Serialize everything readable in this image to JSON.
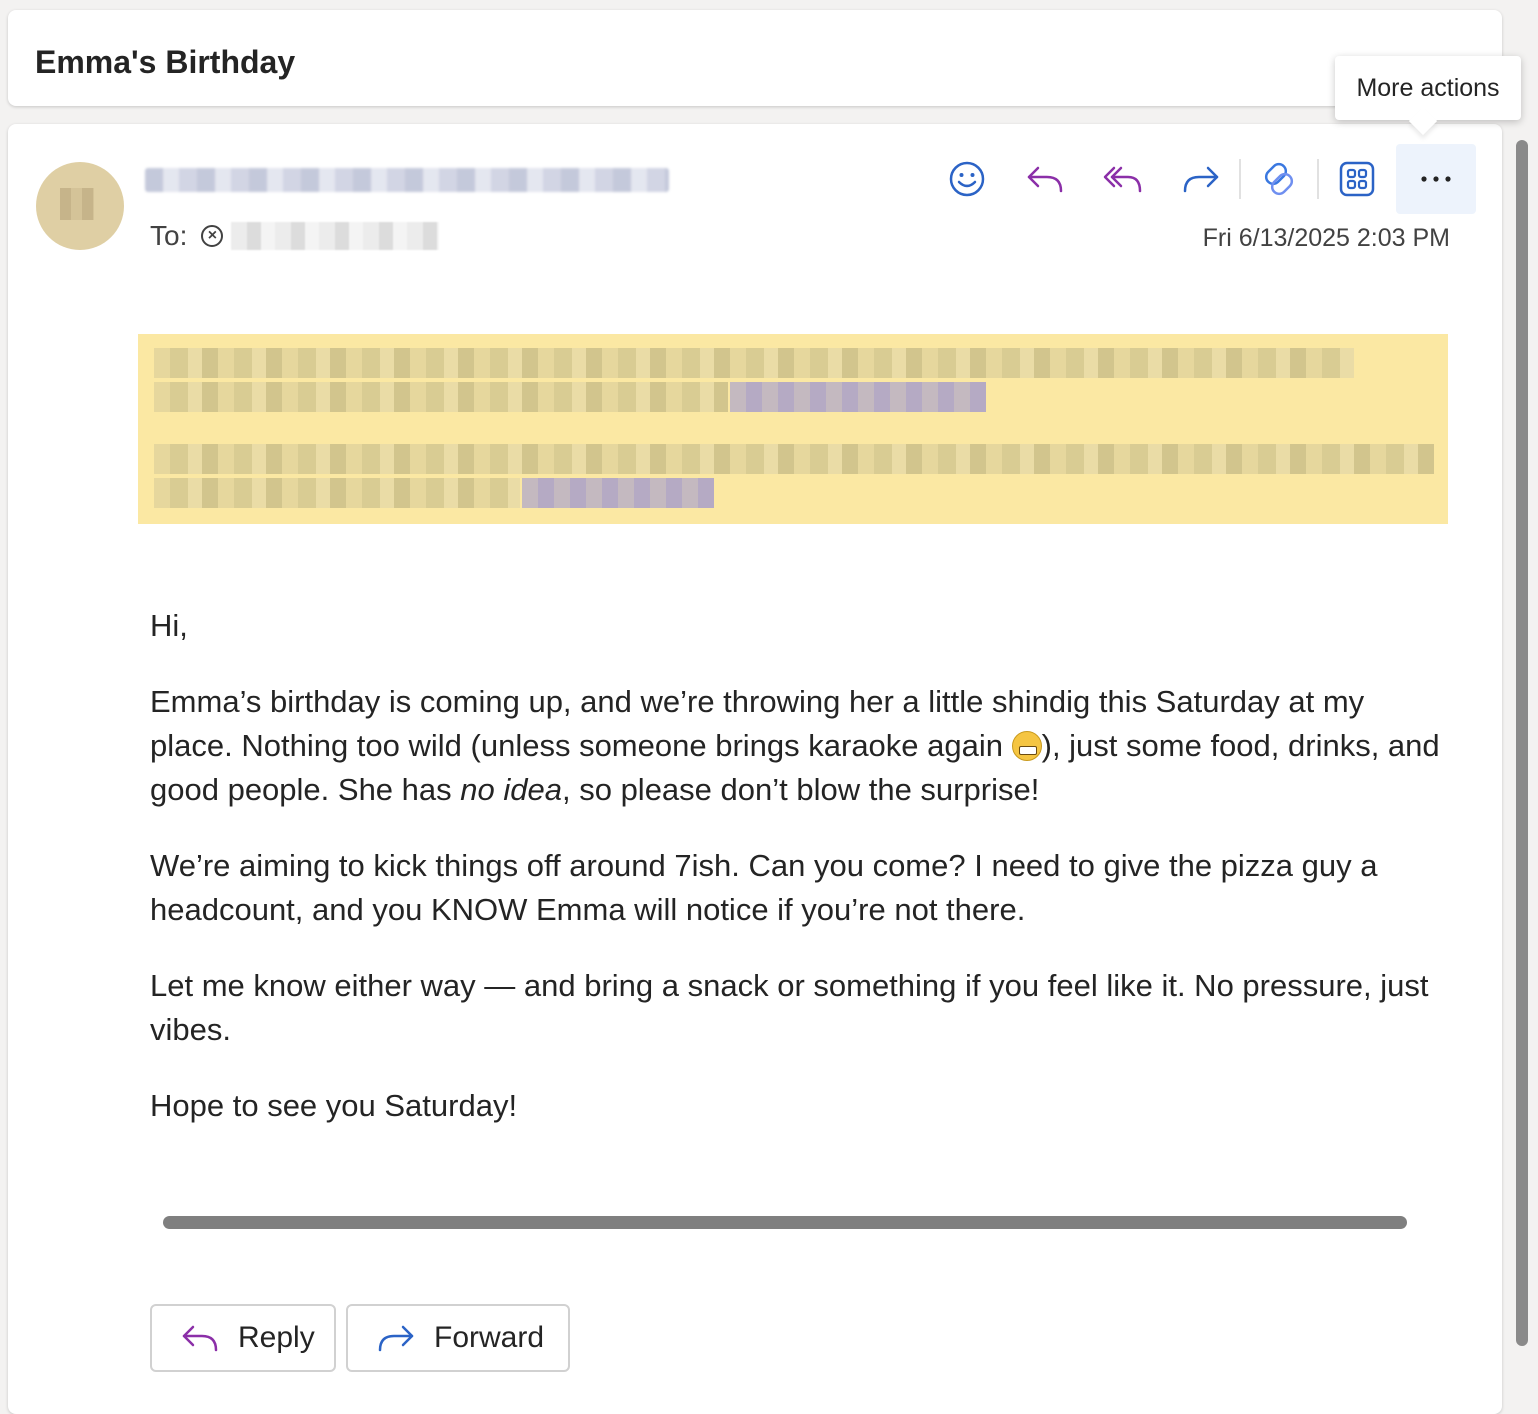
{
  "subject": "Emma's Birthday",
  "header": {
    "to_label": "To:",
    "timestamp": "Fri 6/13/2025 2:03 PM",
    "tooltip": "More actions",
    "toolbar": [
      {
        "name": "emoji-reaction-button",
        "icon": "smiley-icon"
      },
      {
        "name": "reply-button",
        "icon": "reply-icon"
      },
      {
        "name": "reply-all-button",
        "icon": "reply-all-icon"
      },
      {
        "name": "forward-button",
        "icon": "forward-icon"
      },
      {
        "name": "copilot-button",
        "icon": "copilot-icon"
      },
      {
        "name": "apps-button",
        "icon": "apps-grid-icon"
      },
      {
        "name": "more-actions-button",
        "icon": "more-icon"
      }
    ]
  },
  "body": {
    "greeting": "Hi,",
    "p1_a": "Emma’s birthday is coming up, and we’re throwing her a little shindig this Saturday at my place. Nothing too wild (unless someone brings karaoke again ",
    "p1_b": "), just some food, drinks, and good people. She has ",
    "p1_em": "no idea",
    "p1_c": ", so please don’t blow the surprise!",
    "p2": "We’re aiming to kick things off around 7ish. Can you come? I need to give the pizza guy a headcount, and you KNOW Emma will notice if you’re not there.",
    "p3": "Let me know either way — and bring a snack or something if you feel like it. No pressure, just vibes.",
    "p4": "Hope to see you Saturday!"
  },
  "actions": {
    "reply_label": "Reply",
    "forward_label": "Forward"
  },
  "colors": {
    "accent_blue": "#2b63c6",
    "accent_purple": "#8b2fa8",
    "banner_yellow": "#fbe8a3"
  }
}
